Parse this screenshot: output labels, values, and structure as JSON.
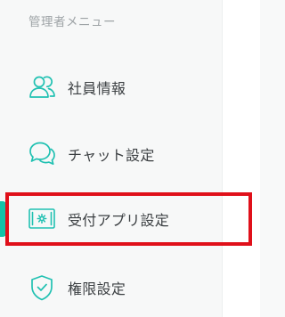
{
  "sidebar": {
    "section_title": "管理者メニュー",
    "items": [
      {
        "label": "社員情報",
        "icon": "users-icon",
        "active": false
      },
      {
        "label": "チャット設定",
        "icon": "chat-bubbles-icon",
        "active": false
      },
      {
        "label": "受付アプリ設定",
        "icon": "tablet-settings-icon",
        "active": true
      },
      {
        "label": "権限設定",
        "icon": "shield-check-icon",
        "active": false
      }
    ]
  },
  "colors": {
    "accent": "#13c3a8",
    "icon": "#21c1b2",
    "text": "#3b3f42",
    "muted_text": "#9ea3a6",
    "highlight_border": "#e0101a",
    "sidebar_bg": "#f7f8f8"
  }
}
